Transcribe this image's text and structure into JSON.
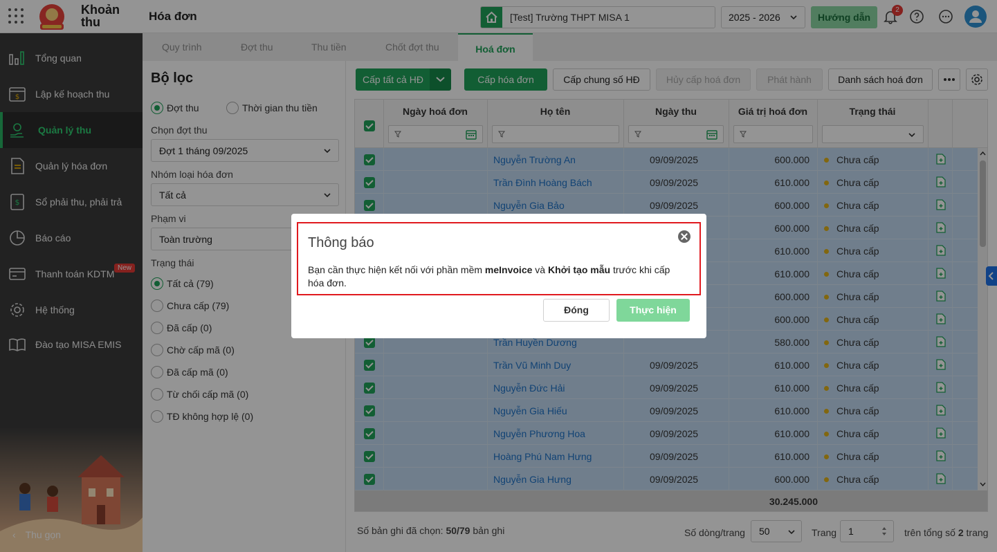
{
  "header": {
    "app_name_line1": "Khoản",
    "app_name_line2": "thu",
    "page_title": "Hóa đơn",
    "school": "[Test] Trường THPT MISA 1",
    "year": "2025 - 2026",
    "guide_label": "Hướng dẫn",
    "notification_count": "2"
  },
  "sidebar": {
    "items": [
      {
        "label": "Tổng quan"
      },
      {
        "label": "Lập kế hoạch thu"
      },
      {
        "label": "Quản lý thu"
      },
      {
        "label": "Quản lý hóa đơn"
      },
      {
        "label": "Sổ phải thu, phải trả"
      },
      {
        "label": "Báo cáo"
      },
      {
        "label": "Thanh toán KDTM"
      },
      {
        "label": "Hệ thống"
      },
      {
        "label": "Đào tạo MISA EMIS"
      }
    ],
    "new_badge": "New",
    "collapse_label": "Thu gọn"
  },
  "tabs": [
    "Quy trình",
    "Đợt thu",
    "Thu tiền",
    "Chốt đợt thu",
    "Hoá đơn"
  ],
  "filter": {
    "title": "Bộ lọc",
    "mode_options": [
      "Đợt thu",
      "Thời gian thu tiền"
    ],
    "period_label": "Chọn đợt thu",
    "period_value": "Đợt 1 tháng 09/2025",
    "group_label": "Nhóm loại hóa đơn",
    "group_value": "Tất cả",
    "scope_label": "Phạm vi",
    "scope_value": "Toàn trường",
    "status_label": "Trạng thái",
    "status_options": [
      "Tất cả (79)",
      "Chưa cấp (79)",
      "Đã cấp (0)",
      "Chờ cấp mã (0)",
      "Đã cấp mã (0)",
      "Từ chối cấp mã (0)",
      "TĐ không hợp lệ (0)"
    ]
  },
  "toolbar": {
    "issue_all": "Cấp tất cả HĐ",
    "issue": "Cấp hóa đơn",
    "issue_common": "Cấp chung số HĐ",
    "cancel_issue": "Hủy cấp hoá đơn",
    "publish": "Phát hành",
    "invoice_list": "Danh sách hoá đơn"
  },
  "table": {
    "headers": [
      "Ngày hoá đơn",
      "Họ tên",
      "Ngày thu",
      "Giá trị hoá đơn",
      "Trạng thái"
    ],
    "rows": [
      {
        "name": "Nguyễn Trường An",
        "date": "09/09/2025",
        "amount": "600.000",
        "status": "Chưa cấp"
      },
      {
        "name": "Trần Đình Hoàng Bách",
        "date": "09/09/2025",
        "amount": "610.000",
        "status": "Chưa cấp"
      },
      {
        "name": "Nguyễn Gia Bảo",
        "date": "09/09/2025",
        "amount": "600.000",
        "status": "Chưa cấp"
      },
      {
        "name": "",
        "date": "",
        "amount": "600.000",
        "status": "Chưa cấp"
      },
      {
        "name": "",
        "date": "",
        "amount": "610.000",
        "status": "Chưa cấp"
      },
      {
        "name": "",
        "date": "",
        "amount": "610.000",
        "status": "Chưa cấp"
      },
      {
        "name": "",
        "date": "",
        "amount": "600.000",
        "status": "Chưa cấp"
      },
      {
        "name": "",
        "date": "",
        "amount": "600.000",
        "status": "Chưa cấp"
      },
      {
        "name": "Trần Huyền Dương",
        "date": "",
        "amount": "580.000",
        "status": "Chưa cấp"
      },
      {
        "name": "Trần Vũ Minh Duy",
        "date": "09/09/2025",
        "amount": "610.000",
        "status": "Chưa cấp"
      },
      {
        "name": "Nguyễn Đức Hải",
        "date": "09/09/2025",
        "amount": "610.000",
        "status": "Chưa cấp"
      },
      {
        "name": "Nguyễn Gia Hiếu",
        "date": "09/09/2025",
        "amount": "610.000",
        "status": "Chưa cấp"
      },
      {
        "name": "Nguyễn Phương Hoa",
        "date": "09/09/2025",
        "amount": "610.000",
        "status": "Chưa cấp"
      },
      {
        "name": "Hoàng Phú Nam Hưng",
        "date": "09/09/2025",
        "amount": "610.000",
        "status": "Chưa cấp"
      },
      {
        "name": "Nguyễn Gia Hưng",
        "date": "09/09/2025",
        "amount": "600.000",
        "status": "Chưa cấp"
      }
    ],
    "total": "30.245.000"
  },
  "footer": {
    "selected_prefix": "Số bản ghi đã chọn:",
    "selected_count": "50/79",
    "selected_suffix": "bản ghi",
    "page_size_label": "Số dòng/trang",
    "page_size": "50",
    "page_label": "Trang",
    "page": "1",
    "total_pages_prefix": "trên tổng số",
    "total_pages": "2",
    "total_pages_suffix": "trang"
  },
  "modal": {
    "title": "Thông báo",
    "msg_1": "Bạn cần thực hiện kết nối với phần mềm ",
    "msg_bold_1": "meInvoice",
    "msg_2": " và ",
    "msg_bold_2": "Khởi tạo mẫu",
    "msg_3": " trước khi cấp hóa đơn.",
    "close_label": "Đóng",
    "confirm_label": "Thực hiện"
  }
}
